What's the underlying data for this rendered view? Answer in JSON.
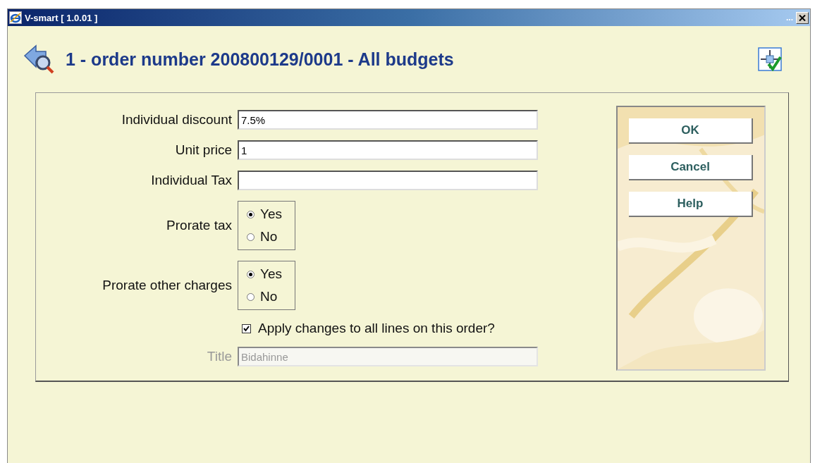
{
  "window": {
    "title": "V-smart [ 1.0.01 ]",
    "more": "..."
  },
  "header": {
    "title": "1 - order number 200800129/0001 - All budgets"
  },
  "form": {
    "fields": [
      {
        "kind": "text",
        "label": "Individual discount",
        "value": "7.5%",
        "disabled": false
      },
      {
        "kind": "text",
        "label": "Unit price",
        "value": "1",
        "disabled": false
      },
      {
        "kind": "text",
        "label": "Individual Tax",
        "disabled": false
      },
      {
        "kind": "radio",
        "label": "Prorate tax",
        "options": [
          {
            "label": "Yes",
            "selected": true
          },
          {
            "label": "No",
            "selected": false
          }
        ]
      },
      {
        "kind": "radio",
        "label": "Prorate other charges",
        "options": [
          {
            "label": "Yes",
            "selected": true
          },
          {
            "label": "No",
            "selected": false
          }
        ]
      },
      {
        "kind": "checkbox",
        "label": "Apply changes to all lines on this order?",
        "checked": true
      },
      {
        "kind": "text",
        "label": "Title",
        "value": "Bidahinne",
        "disabled": true
      }
    ]
  },
  "buttons": [
    "OK",
    "Cancel",
    "Help"
  ]
}
